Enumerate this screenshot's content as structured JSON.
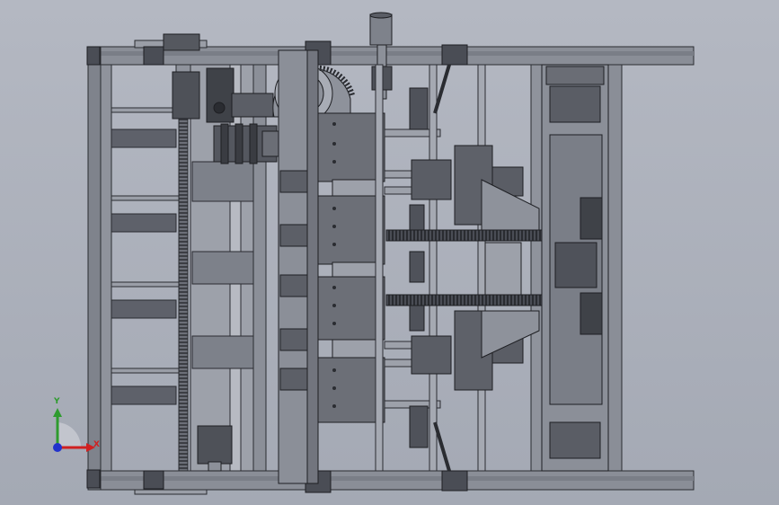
{
  "viewport": {
    "background_color": "#adb1bb",
    "model_type": "cad-assembly-top-view",
    "render_style": "shaded-with-edges"
  },
  "triad": {
    "y_label": "Y",
    "x_label": "X",
    "y_color": "#2e9b2e",
    "x_color": "#d02020",
    "z_color": "#2233cc"
  }
}
